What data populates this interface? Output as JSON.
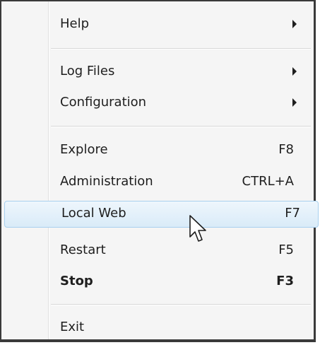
{
  "menu": {
    "help": {
      "label": "Help",
      "has_submenu": true
    },
    "log_files": {
      "label": "Log Files",
      "has_submenu": true
    },
    "configuration": {
      "label": "Configuration",
      "has_submenu": true
    },
    "explore": {
      "label": "Explore",
      "shortcut": "F8"
    },
    "administration": {
      "label": "Administration",
      "shortcut": "CTRL+A"
    },
    "local_web": {
      "label": "Local Web",
      "shortcut": "F7",
      "highlighted": true
    },
    "restart": {
      "label": "Restart",
      "shortcut": "F5"
    },
    "stop": {
      "label": "Stop",
      "shortcut": "F3",
      "bold": true
    },
    "exit": {
      "label": "Exit"
    }
  },
  "colors": {
    "menu_background": "#f5f5f5",
    "highlight_border": "#a8d0ee",
    "highlight_fill": "#d9ebf8",
    "text": "#1e1e1e"
  },
  "icons": {
    "submenu_arrow": "submenu-arrow-icon",
    "cursor": "mouse-cursor-icon"
  }
}
